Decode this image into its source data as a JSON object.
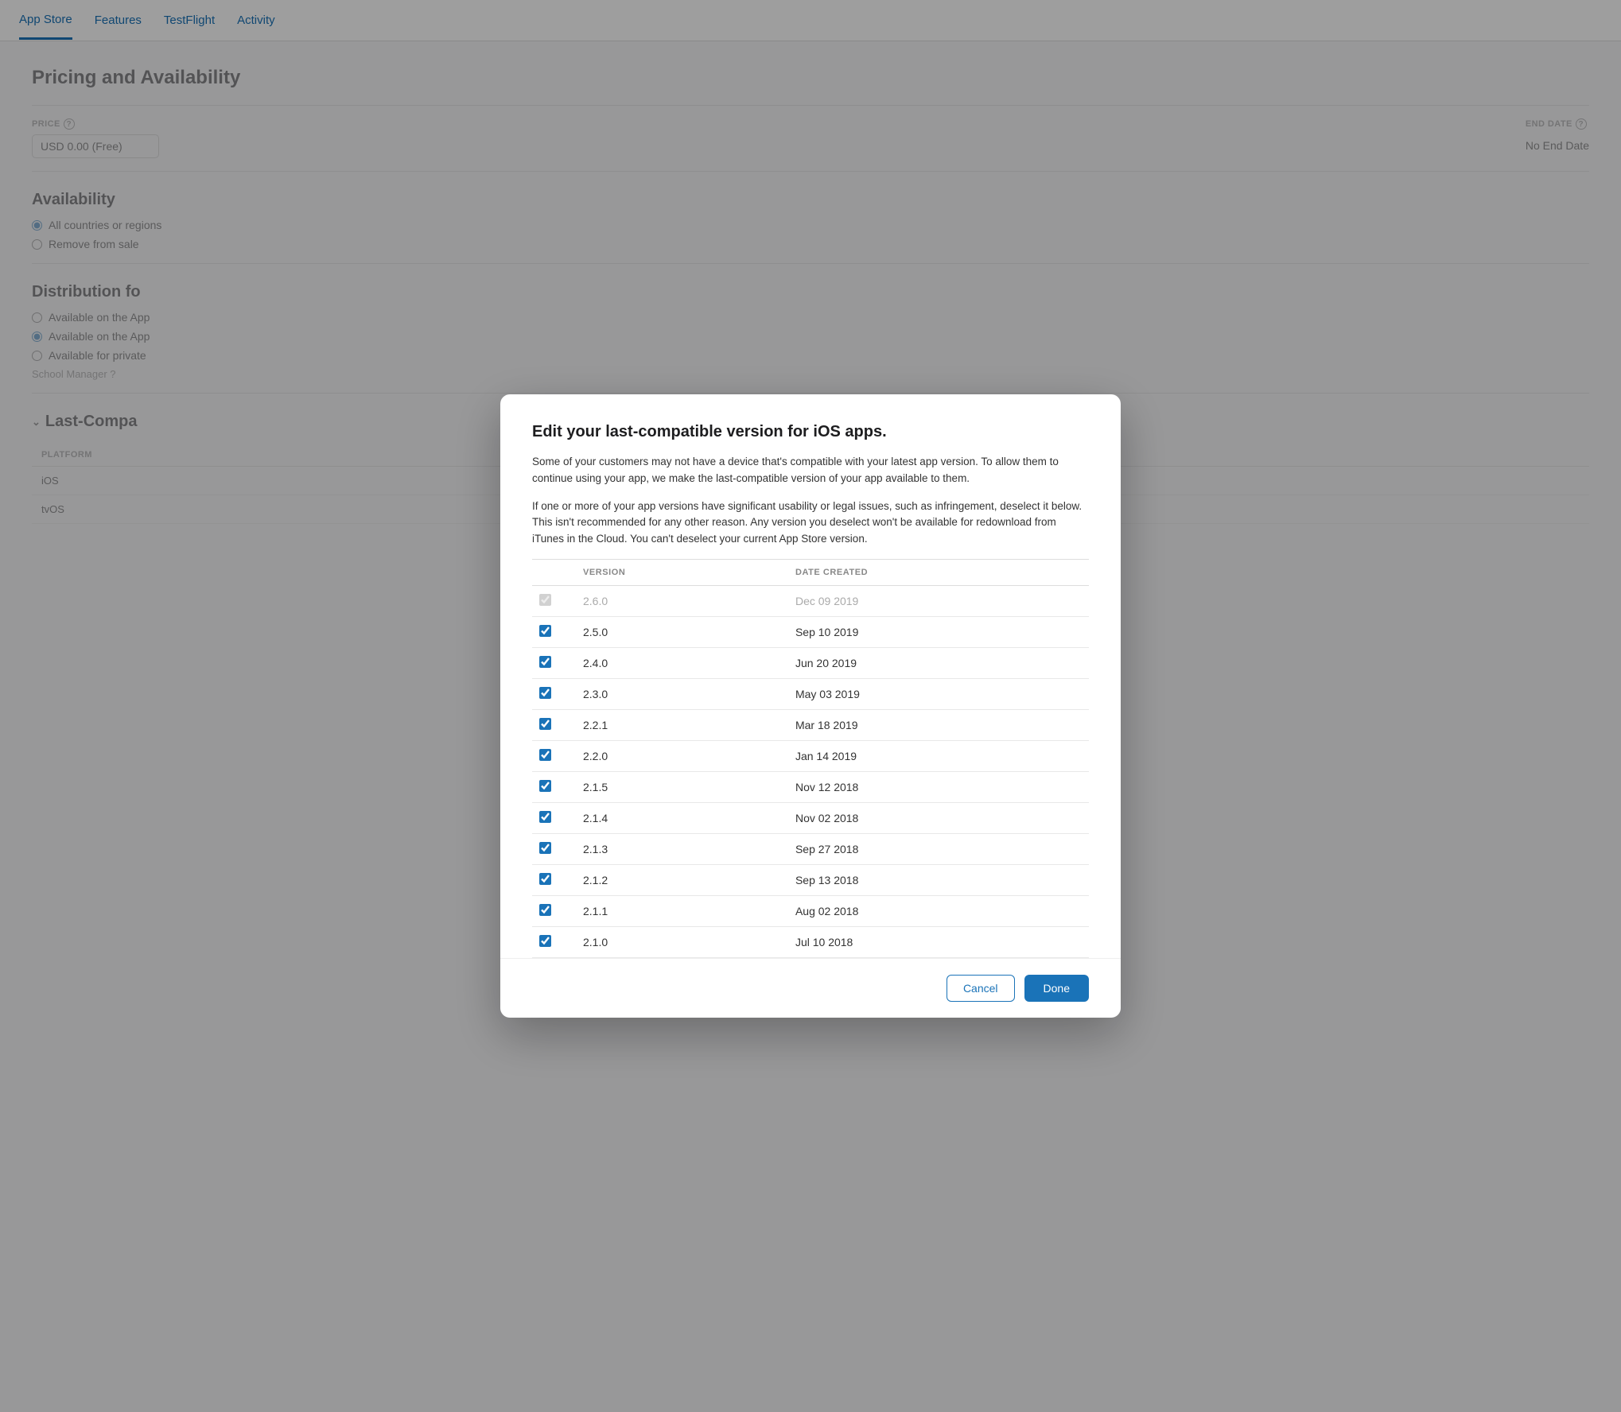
{
  "nav": {
    "items": [
      {
        "id": "app-store",
        "label": "App Store",
        "active": true
      },
      {
        "id": "features",
        "label": "Features",
        "active": false
      },
      {
        "id": "testflight",
        "label": "TestFlight",
        "active": false
      },
      {
        "id": "activity",
        "label": "Activity",
        "active": false
      }
    ]
  },
  "page": {
    "title": "Pricing and Availability",
    "price_label": "PRICE",
    "price_help": "?",
    "price_value": "USD 0.00 (Free)",
    "end_date_label": "END DATE",
    "end_date_help": "?",
    "end_date_value": "No End Date",
    "availability_title": "Availability",
    "availability_options": [
      {
        "label": "All countries or regions",
        "checked": true
      },
      {
        "label": "Remove from sale",
        "checked": false
      }
    ],
    "distribution_title": "Distribution fo",
    "distribution_options": [
      {
        "label": "Available on the App",
        "checked": false
      },
      {
        "label": "Available on the App",
        "checked": true
      },
      {
        "label": "Available for private",
        "checked": false
      }
    ],
    "school_manager_label": "School Manager",
    "school_manager_help": "?",
    "last_compat_title": "Last-Compa",
    "platform_label": "PLATFORM",
    "platforms": [
      {
        "name": "iOS"
      },
      {
        "name": "tvOS"
      }
    ]
  },
  "modal": {
    "title": "Edit your last-compatible version for iOS apps.",
    "description1": "Some of your customers may not have a device that's compatible with your latest app version. To allow them to continue using your app, we make the last-compatible version of your app available to them.",
    "description2": "If one or more of your app versions have significant usability or legal issues, such as infringement, deselect it below. This isn't recommended for any other reason. Any version you deselect won't be available for redownload from iTunes in the Cloud. You can't deselect your current App Store version.",
    "col_version": "VERSION",
    "col_date": "DATE CREATED",
    "versions": [
      {
        "version": "2.6.0",
        "date": "Dec 09 2019",
        "checked": true,
        "disabled": true
      },
      {
        "version": "2.5.0",
        "date": "Sep 10 2019",
        "checked": true,
        "disabled": false
      },
      {
        "version": "2.4.0",
        "date": "Jun 20 2019",
        "checked": true,
        "disabled": false
      },
      {
        "version": "2.3.0",
        "date": "May 03 2019",
        "checked": true,
        "disabled": false
      },
      {
        "version": "2.2.1",
        "date": "Mar 18 2019",
        "checked": true,
        "disabled": false
      },
      {
        "version": "2.2.0",
        "date": "Jan 14 2019",
        "checked": true,
        "disabled": false
      },
      {
        "version": "2.1.5",
        "date": "Nov 12 2018",
        "checked": true,
        "disabled": false
      },
      {
        "version": "2.1.4",
        "date": "Nov 02 2018",
        "checked": true,
        "disabled": false
      },
      {
        "version": "2.1.3",
        "date": "Sep 27 2018",
        "checked": true,
        "disabled": false
      },
      {
        "version": "2.1.2",
        "date": "Sep 13 2018",
        "checked": true,
        "disabled": false
      },
      {
        "version": "2.1.1",
        "date": "Aug 02 2018",
        "checked": true,
        "disabled": false
      },
      {
        "version": "2.1.0",
        "date": "Jul 10 2018",
        "checked": true,
        "disabled": false
      }
    ],
    "cancel_label": "Cancel",
    "done_label": "Done"
  }
}
